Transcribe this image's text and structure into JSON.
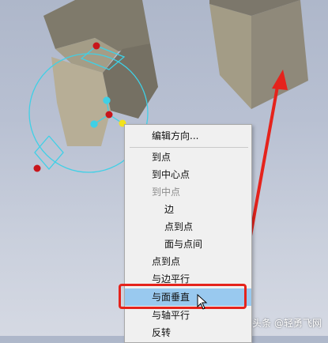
{
  "context_menu": {
    "items": [
      {
        "label": "编辑方向...",
        "state": "normal",
        "indent": false
      },
      {
        "label": "到点",
        "state": "normal",
        "indent": false
      },
      {
        "label": "到中心点",
        "state": "normal",
        "indent": false
      },
      {
        "label": "到中点",
        "state": "disabled",
        "indent": false
      },
      {
        "label": "边",
        "state": "normal",
        "indent": true
      },
      {
        "label": "点到点",
        "state": "normal",
        "indent": true
      },
      {
        "label": "面与点间",
        "state": "normal",
        "indent": true
      },
      {
        "label": "点到点",
        "state": "normal",
        "indent": false
      },
      {
        "label": "与边平行",
        "state": "normal",
        "indent": false
      },
      {
        "label": "与面垂直",
        "state": "highlighted",
        "indent": false
      },
      {
        "label": "与轴平行",
        "state": "normal",
        "indent": false
      },
      {
        "label": "反转",
        "state": "normal",
        "indent": false
      }
    ]
  },
  "watermark": "头条 @轻勇飞网",
  "colors": {
    "annotation": "#e5231c",
    "menu_highlight": "#99c9ef",
    "gizmo": "#3fd0e6",
    "solid_face": "#9c957f",
    "handle": "#c8151b"
  },
  "icons": [
    "mouse-pointer-icon",
    "rotation-gizmo-icon"
  ]
}
